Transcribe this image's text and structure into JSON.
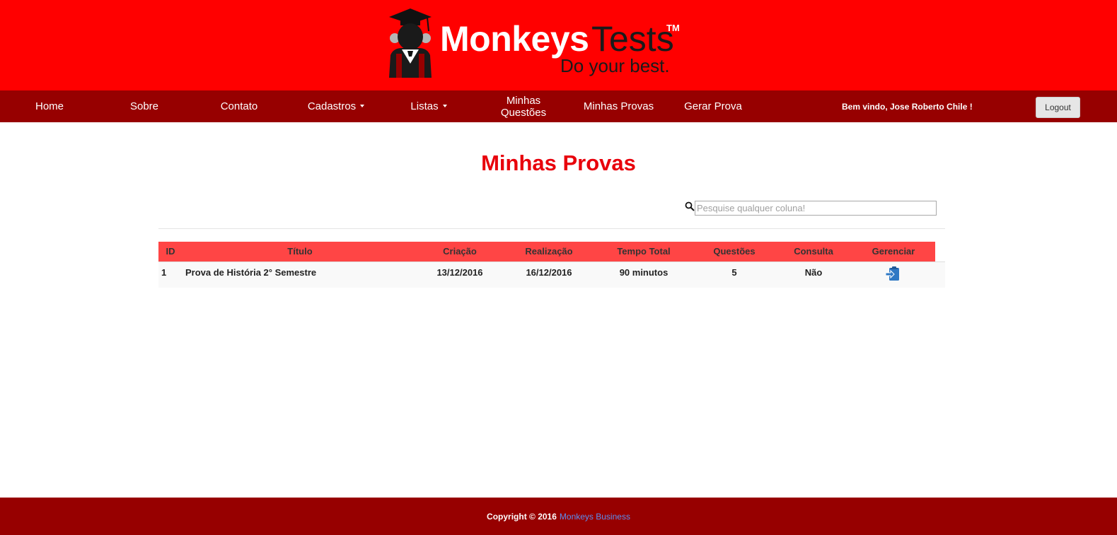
{
  "brand": {
    "name_part1": "Monkeys",
    "name_part2": "Tests",
    "tm": "TM",
    "tagline": "Do your best.",
    "colors": {
      "header": "#ff0000",
      "nav": "#970000",
      "title": "#e8000b",
      "table_header": "#ff4545"
    }
  },
  "nav": {
    "items": [
      {
        "label": "Home"
      },
      {
        "label": "Sobre"
      },
      {
        "label": "Contato"
      },
      {
        "label": "Cadastros",
        "dropdown": true
      },
      {
        "label": "Listas",
        "dropdown": true
      },
      {
        "label": "Minhas Questões"
      },
      {
        "label": "Minhas Provas"
      },
      {
        "label": "Gerar Prova"
      }
    ],
    "welcome": "Bem vindo, Jose Roberto Chile !",
    "logout": "Logout"
  },
  "main": {
    "title": "Minhas Provas",
    "search": {
      "placeholder": "Pesquise qualquer coluna!",
      "value": "",
      "icon": "search-icon"
    },
    "table": {
      "columns": [
        "ID",
        "Título",
        "Criação",
        "Realização",
        "Tempo Total",
        "Questões",
        "Consulta",
        "Gerenciar"
      ],
      "rows": [
        {
          "id": "1",
          "titulo": "Prova de História 2° Semestre",
          "criacao": "13/12/2016",
          "realizacao": "16/12/2016",
          "tempo_total": "90 minutos",
          "questoes": "5",
          "consulta": "Não",
          "gerenciar_icon": "manage-exam-icon"
        }
      ]
    }
  },
  "footer": {
    "copyright": "Copyright © 2016",
    "link": "Monkeys Business"
  }
}
